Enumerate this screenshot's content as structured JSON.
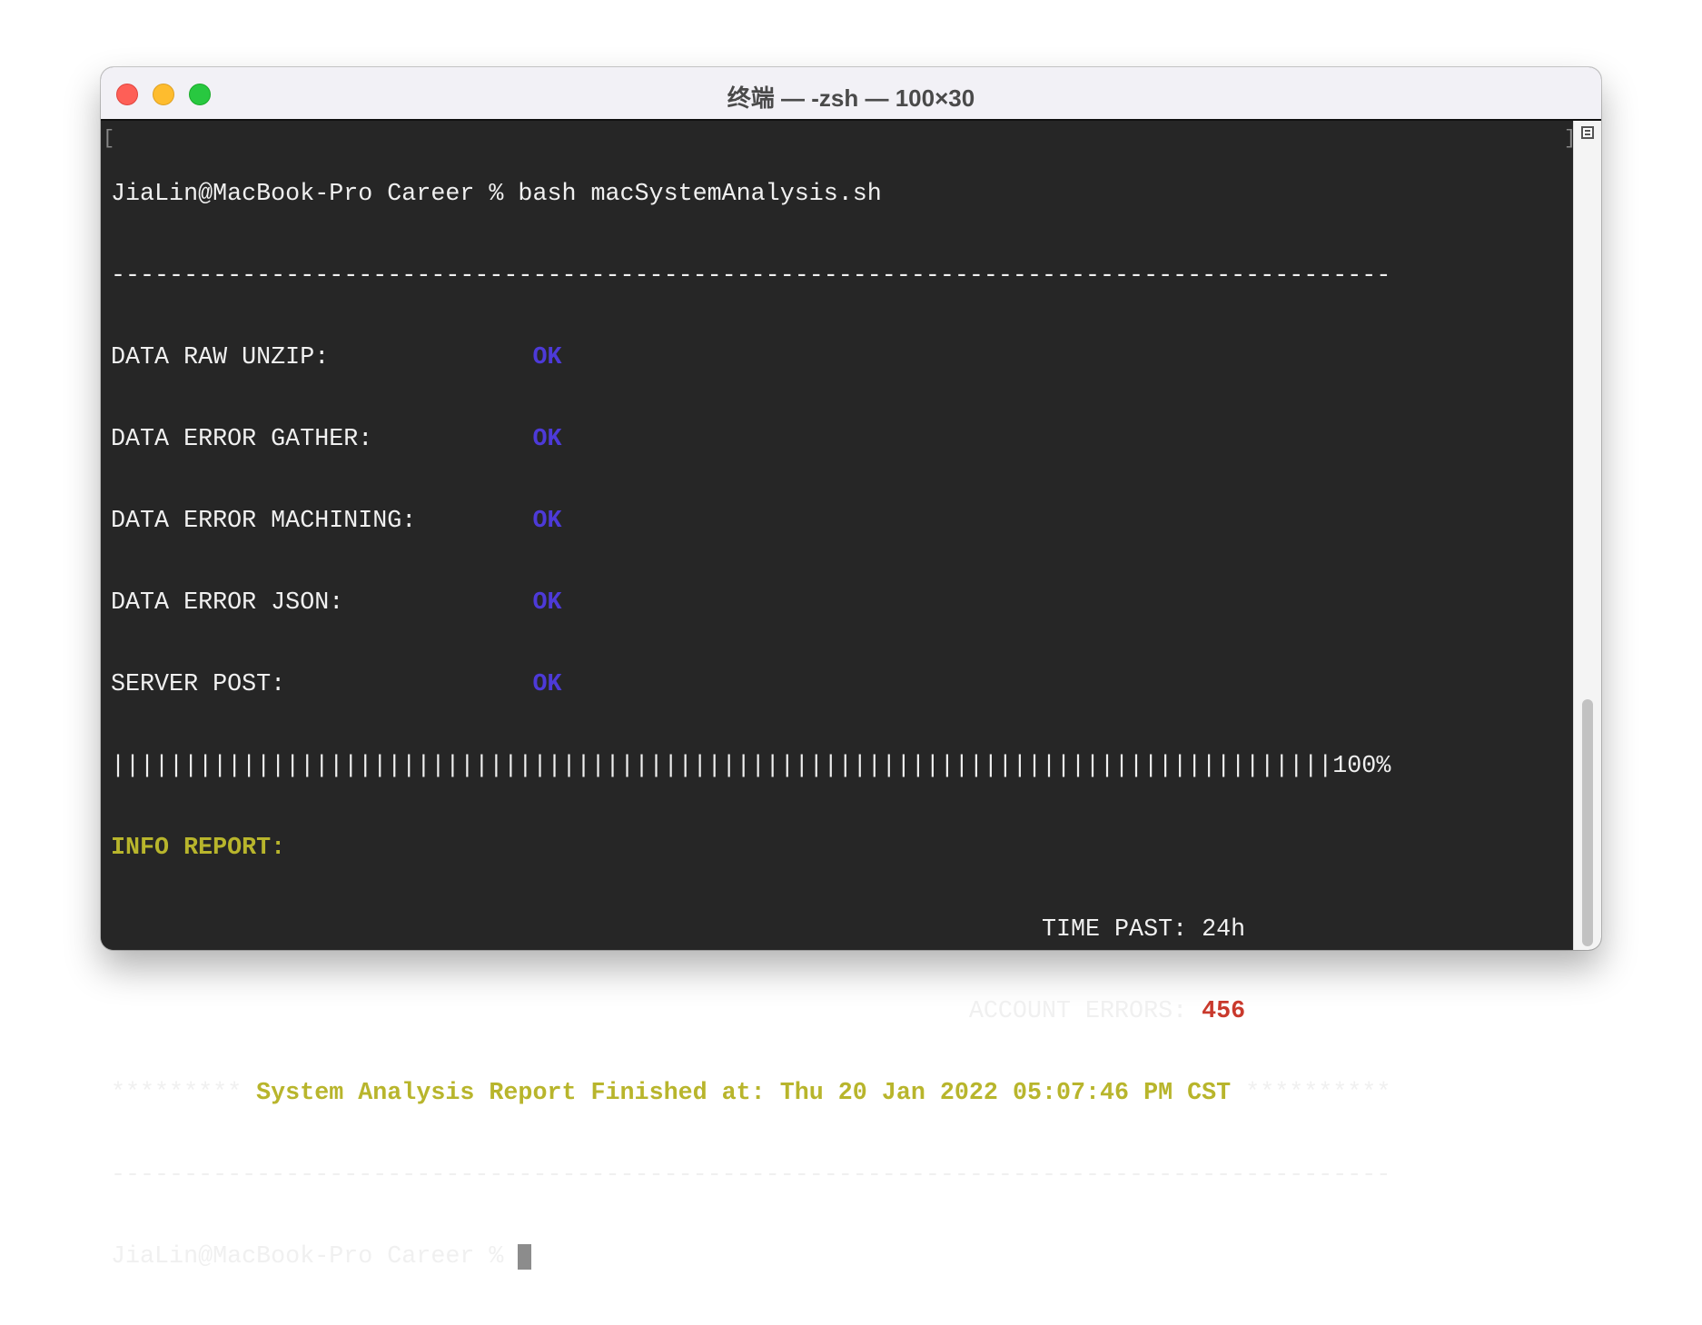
{
  "window": {
    "title": "终端 — -zsh — 100×30"
  },
  "colors": {
    "ok": "#4d3ad8",
    "highlight": "#b8b52c",
    "error": "#c9392c",
    "background": "#262626"
  },
  "terminal": {
    "command_line": "JiaLin@MacBook-Pro Career % bash macSystemAnalysis.sh",
    "divider": "----------------------------------------------------------------------------------------",
    "checks": [
      {
        "label": "DATA RAW UNZIP:              ",
        "status": "OK"
      },
      {
        "label": "DATA ERROR GATHER:           ",
        "status": "OK"
      },
      {
        "label": "DATA ERROR MACHINING:        ",
        "status": "OK"
      },
      {
        "label": "DATA ERROR JSON:             ",
        "status": "OK"
      },
      {
        "label": "SERVER POST:                 ",
        "status": "OK"
      }
    ],
    "progress_bar": "||||||||||||||||||||||||||||||||||||||||||||||||||||||||||||||||||||||||||||||||||||",
    "progress_text": "100%",
    "progress_percent": 100,
    "info_report": "INFO REPORT:",
    "time_past_label": "                                                                TIME PAST: 24h",
    "account_errors_label": "                                                           ACCOUNT ERRORS: ",
    "account_errors_value": "456",
    "stars_left": "********* ",
    "finish_message": "System Analysis Report Finished at: Thu 20 Jan 2022 05:07:46 PM CST",
    "stars_right": " **********",
    "prompt": "JiaLin@MacBook-Pro Career % "
  }
}
